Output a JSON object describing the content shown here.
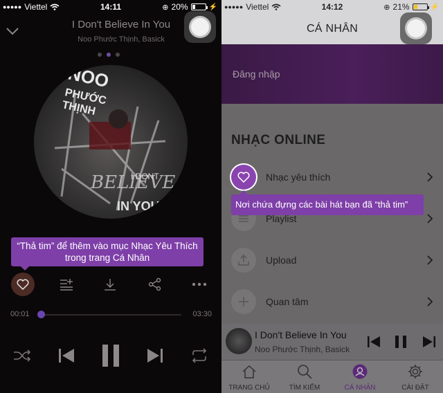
{
  "left": {
    "status": {
      "carrier": "Viettel",
      "time": "14:11",
      "battery": "20%"
    },
    "now_playing": {
      "title": "I Don't Believe In You",
      "artist": "Noo Phước Thịnh, Basick"
    },
    "album_text": [
      "NOO",
      "PHƯỚC",
      "THỊNH",
      "I DONT",
      "BELIEVE",
      "IN YOU"
    ],
    "tooltip": "“Thả tim” để thêm vào mục Nhạc Yêu Thích trong trang Cá Nhân",
    "progress": {
      "elapsed": "00:01",
      "duration": "03:30",
      "fraction": 0.01
    },
    "icons": {
      "heart": "heart-icon",
      "add_playlist": "add-to-playlist-icon",
      "download": "download-icon",
      "share": "share-icon",
      "more": "more-icon",
      "shuffle": "shuffle-icon",
      "prev": "previous-icon",
      "pause": "pause-icon",
      "next": "next-icon",
      "repeat": "repeat-icon"
    }
  },
  "right": {
    "status": {
      "carrier": "Viettel",
      "time": "14:12",
      "battery": "21%"
    },
    "header_title": "CÁ NHÂN",
    "login_label": "Đăng nhập",
    "section_title": "NHẠC ONLINE",
    "menu": [
      {
        "label": "Nhạc yêu thích",
        "icon": "heart-icon"
      },
      {
        "label": "Playlist",
        "icon": "playlist-icon"
      },
      {
        "label": "Upload",
        "icon": "upload-icon"
      },
      {
        "label": "Quan tâm",
        "icon": "plus-icon"
      }
    ],
    "tooltip": "Nơi chứa đựng các bài hát bạn đã “thả tim”",
    "mini_player": {
      "title": "I Don't Believe In You",
      "artist": "Noo Phước Thịnh, Basick"
    },
    "tabs": [
      {
        "label": "TRANG CHỦ",
        "icon": "home-icon",
        "active": false
      },
      {
        "label": "TÌM KIẾM",
        "icon": "search-icon",
        "active": false
      },
      {
        "label": "CÁ NHÂN",
        "icon": "profile-icon",
        "active": true
      },
      {
        "label": "CÀI ĐẶT",
        "icon": "settings-icon",
        "active": false
      }
    ]
  },
  "colors": {
    "accent_purple": "#7e3fa8",
    "player_background": "#0b0809",
    "battery_low": "#ffffff",
    "battery_yellow": "#f2c31a"
  }
}
